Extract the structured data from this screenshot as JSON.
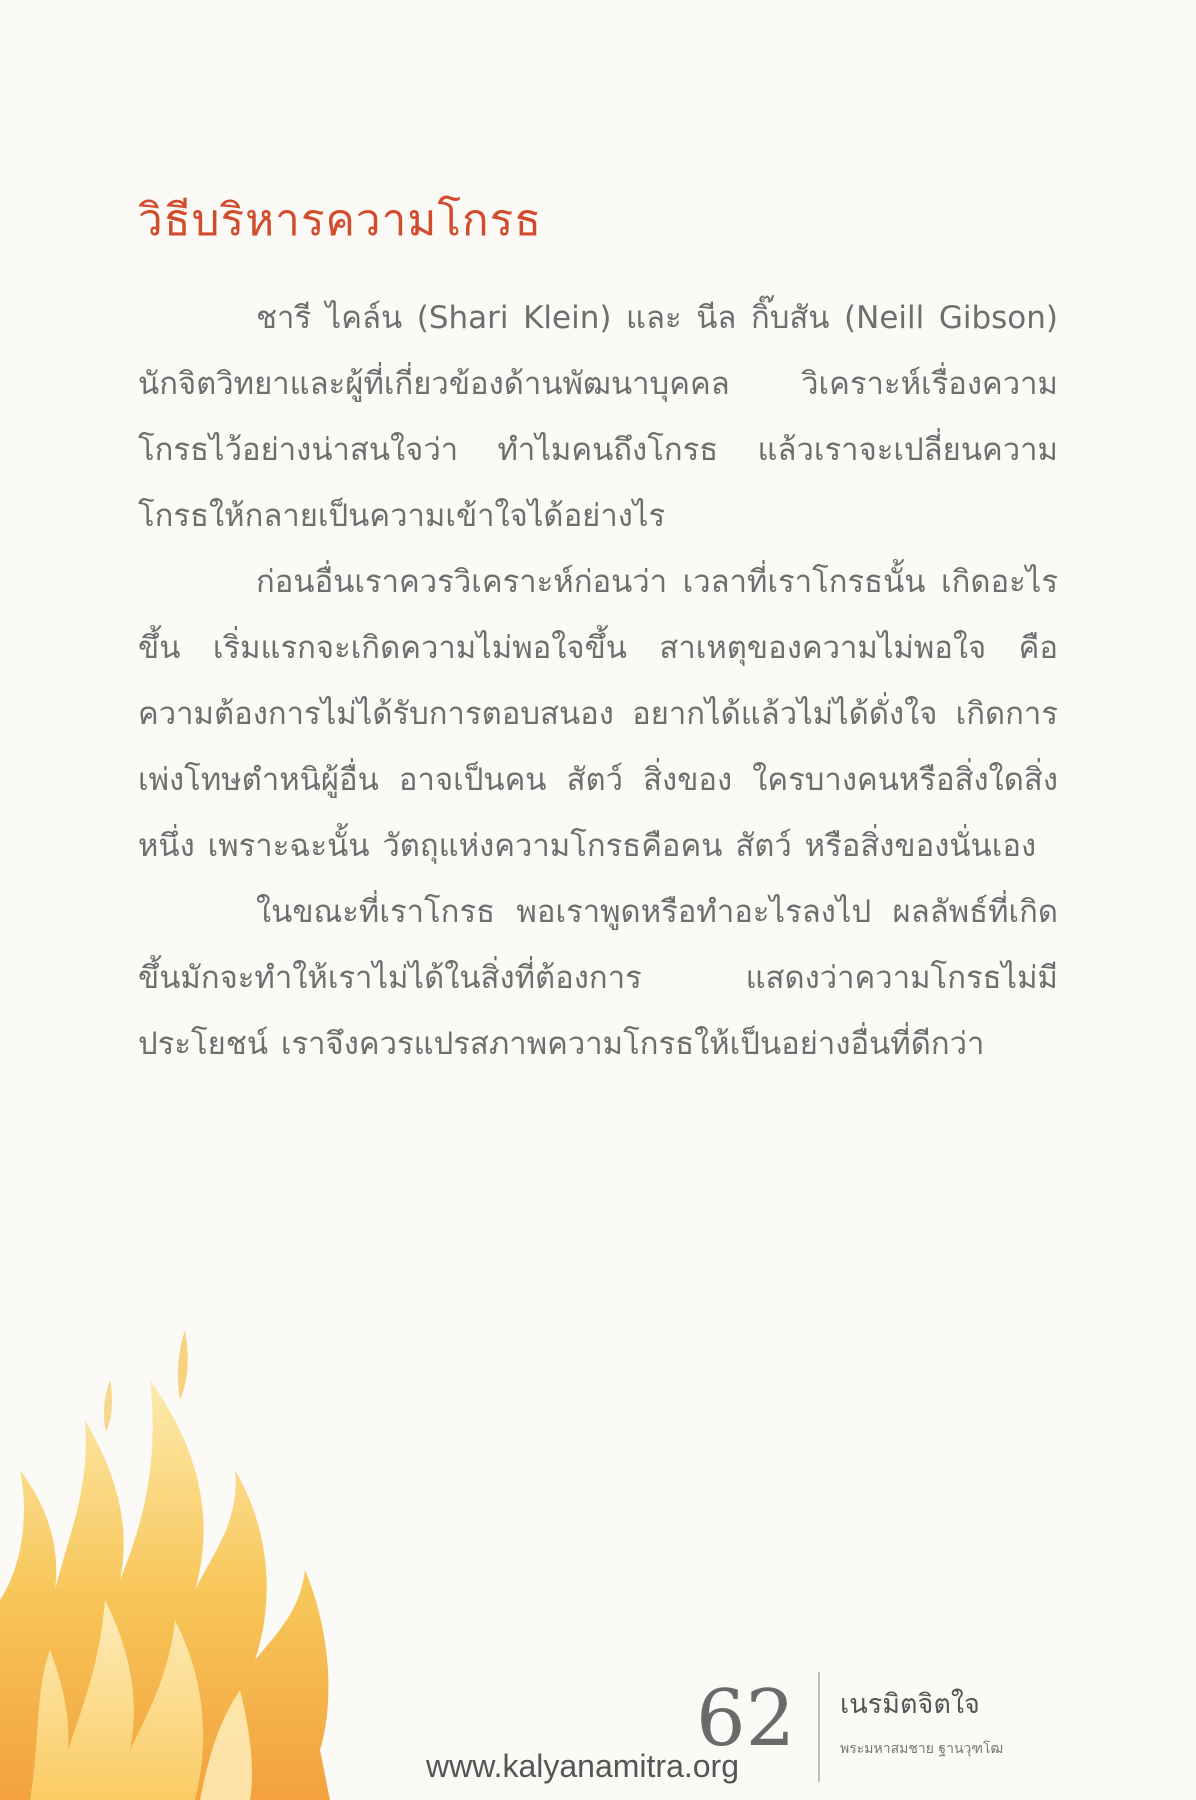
{
  "section_title": "วิธีบริหารความโกรธ",
  "paragraphs": [
    "ชารี ไคล์น (Shari Klein) และ นีล กิ๊บสัน (Neill Gibson) นักจิตวิทยาและผู้ที่เกี่ยวข้องด้านพัฒนาบุคคล วิเคราะห์เรื่องความโกรธไว้อย่างน่าสนใจว่า ทำไมคนถึงโกรธ แล้วเราจะเปลี่ยนความโกรธให้กลายเป็นความเข้าใจได้อย่างไร",
    "ก่อนอื่นเราควรวิเคราะห์ก่อนว่า เวลาที่เราโกรธนั้น เกิดอะไรขึ้น เริ่มแรกจะเกิดความไม่พอใจขึ้น สาเหตุของความไม่พอใจ คือความต้องการไม่ได้รับการตอบสนอง อยากได้แล้วไม่ได้ดั่งใจ เกิดการเพ่งโทษตำหนิผู้อื่น อาจเป็นคน สัตว์ สิ่งของ ใครบางคนหรือสิ่งใดสิ่งหนึ่ง เพราะฉะนั้น วัตถุแห่งความโกรธคือคน สัตว์ หรือสิ่งของนั่นเอง",
    "ในขณะที่เราโกรธ พอเราพูดหรือทำอะไรลงไป ผลลัพธ์ที่เกิดขึ้นมักจะทำให้เราไม่ได้ในสิ่งที่ต้องการ แสดงว่าความโกรธไม่มีประโยชน์ เราจึงควรแปรสภาพความโกรธให้เป็นอย่างอื่นที่ดีกว่า"
  ],
  "footer": {
    "page_number": "62",
    "book_title": "เนรมิตจิตใจ",
    "author": "พระมหาสมชาย ฐานวุฑโฒ"
  },
  "watermark": "www.kalyanamitra.org",
  "colors": {
    "title": "#d24b2a",
    "body_text": "#6e6e6e",
    "flame_outer": "#f4b43c",
    "flame_inner": "#fde8a0"
  },
  "icons": [
    "flame-illustration"
  ]
}
